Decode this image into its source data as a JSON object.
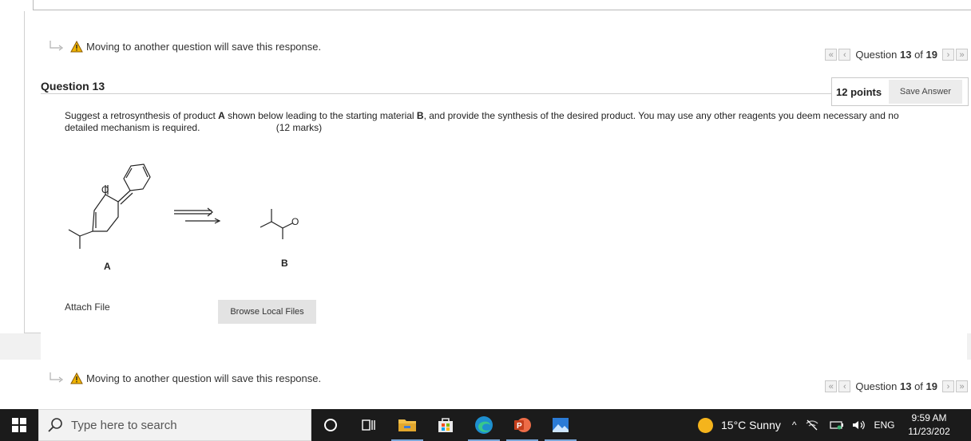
{
  "notice": {
    "text": "Moving to another question will save this response."
  },
  "nav": {
    "question_prefix": "Question ",
    "question_number": "13",
    "question_of": " of ",
    "question_total": "19",
    "first_glyph": "«",
    "prev_glyph": "‹",
    "next_glyph": "›",
    "last_glyph": "»"
  },
  "question": {
    "title": "Question 13",
    "points": "12 points",
    "save_label": "Save Answer",
    "text_part1": "Suggest a retrosynthesis of product ",
    "text_A": "A",
    "text_part2": " shown below leading to the starting material ",
    "text_B": "B",
    "text_part3": ", and provide the synthesis of the desired product. You may use any other reagents you deem necessary   and no detailed mechanism is required.",
    "marks": "(12 marks)",
    "label_A": "A",
    "label_B": "B",
    "label_O_A": "O",
    "label_O_B": "O"
  },
  "attach": {
    "label": "Attach File",
    "browse_label": "Browse Local Files"
  },
  "taskbar": {
    "search_placeholder": "Type here to search",
    "weather": "15°C  Sunny",
    "language": "ENG",
    "time": "9:59 AM",
    "date": "11/23/202"
  },
  "colors": {
    "taskbar_bg": "#1b1b1b",
    "warning": "#f0b400",
    "button_bg": "#e3e3e3"
  }
}
